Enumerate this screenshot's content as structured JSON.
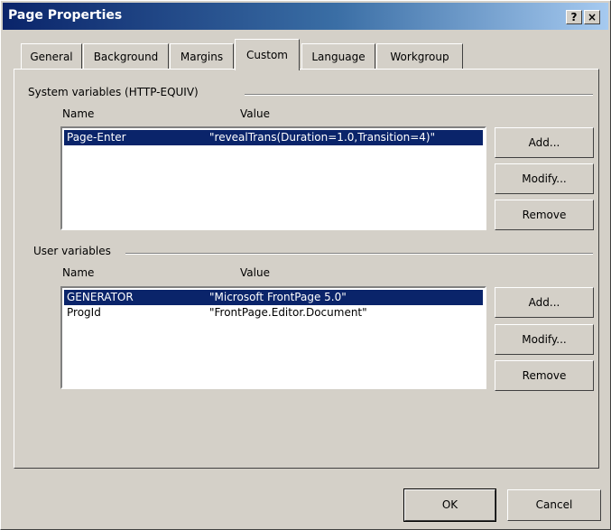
{
  "window": {
    "title": "Page Properties",
    "help_label": "?",
    "close_label": "×"
  },
  "tabs": [
    {
      "label": "General"
    },
    {
      "label": "Background"
    },
    {
      "label": "Margins"
    },
    {
      "label": "Custom",
      "active": true
    },
    {
      "label": "Language"
    },
    {
      "label": "Workgroup"
    }
  ],
  "system_vars": {
    "group_label": "System variables (HTTP-EQUIV)",
    "col_name": "Name",
    "col_value": "Value",
    "rows": [
      {
        "name": "Page-Enter",
        "value": "\"revealTrans(Duration=1.0,Transition=4)\"",
        "selected": true
      }
    ],
    "buttons": {
      "add": "Add...",
      "modify": "Modify...",
      "remove": "Remove"
    }
  },
  "user_vars": {
    "group_label": "User variables",
    "col_name": "Name",
    "col_value": "Value",
    "rows": [
      {
        "name": "GENERATOR",
        "value": "\"Microsoft FrontPage 5.0\"",
        "selected": true
      },
      {
        "name": "ProgId",
        "value": "\"FrontPage.Editor.Document\"",
        "selected": false
      }
    ],
    "buttons": {
      "add": "Add...",
      "modify": "Modify...",
      "remove": "Remove"
    }
  },
  "footer": {
    "ok_label": "OK",
    "cancel_label": "Cancel"
  }
}
